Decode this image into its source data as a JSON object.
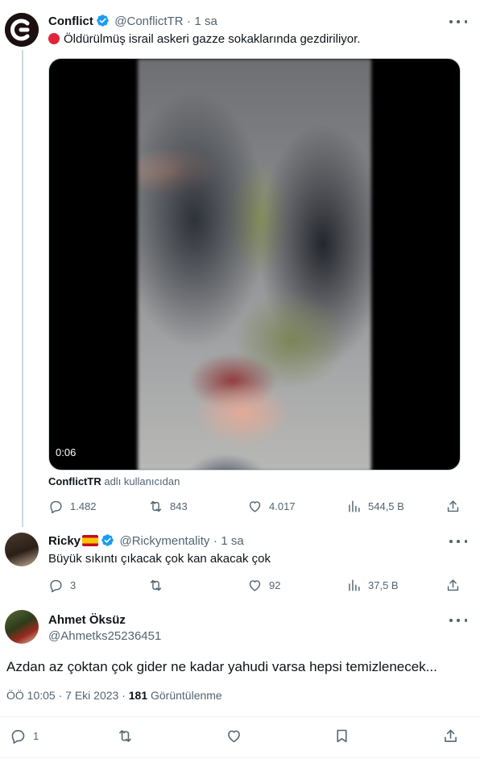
{
  "tweet": {
    "name": "Conflict",
    "handle": "@ConflictTR",
    "separator": "·",
    "time": "1 sa",
    "text": "Öldürülmüş israil askeri gazze sokaklarında gezdiriliyor.",
    "video_duration": "0:06",
    "attribution_user": "ConflictTR",
    "attribution_suffix": "adlı kullanıcıdan",
    "stats": {
      "replies": "1.482",
      "retweets": "843",
      "likes": "4.017",
      "views": "544,5 B"
    }
  },
  "reply1": {
    "name": "Ricky",
    "handle": "@Rickymentality",
    "separator": "·",
    "time": "1 sa",
    "text": "Büyük sıkıntı çıkacak çok kan akacak çok",
    "stats": {
      "replies": "3",
      "retweets": "",
      "likes": "92",
      "views": "37,5 B"
    }
  },
  "focused": {
    "name": "Ahmet Öksüz",
    "handle": "@Ahmetks25236451",
    "text": "Azdan az çoktan çok gider ne kadar yahudi varsa hepsi temizlenecek...",
    "timestamp": "ÖÖ 10:05 · 7 Eki 2023 ·",
    "views_count": "181",
    "views_label": "Görüntülenme",
    "stats": {
      "replies": "1"
    }
  },
  "colors": {
    "verified": "#1d9bf0",
    "muted": "#536471",
    "text": "#0f1419",
    "live_dot": "#e0253a"
  },
  "icons": [
    "verified-badge-icon",
    "more-icon",
    "reply-icon",
    "retweet-icon",
    "like-icon",
    "views-icon",
    "share-icon",
    "bookmark-icon",
    "flag-spain-icon",
    "red-circle-emoji-icon",
    "conflict-logo-icon"
  ]
}
